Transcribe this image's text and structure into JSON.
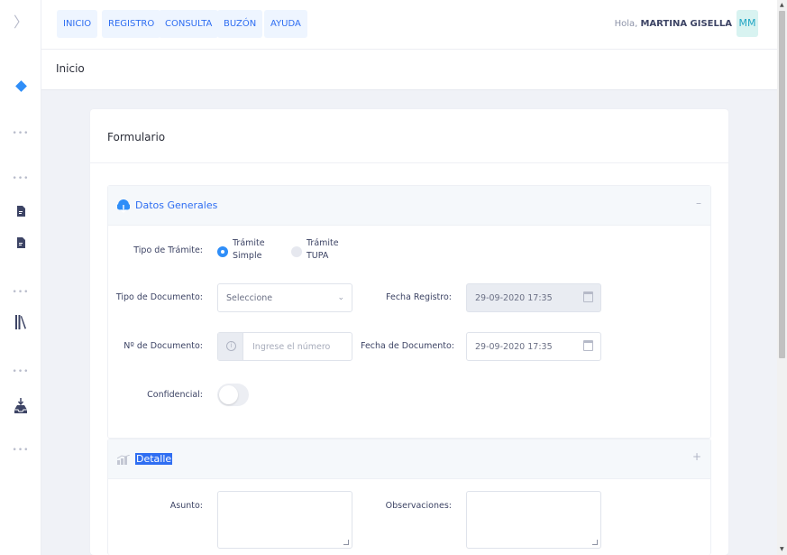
{
  "rail": {
    "expander": "〉",
    "dots": "•••"
  },
  "topbar": {
    "nav": [
      "INICIO",
      "REGISTRO",
      "CONSULTA",
      "BUZÓN",
      "AYUDA"
    ],
    "greeting_prefix": "Hola, ",
    "user_name": "MARTINA GISELLA",
    "avatar_initials": "MM"
  },
  "subheader": {
    "title": "Inicio"
  },
  "card": {
    "title": "Formulario",
    "general": {
      "title": "Datos Generales",
      "toggle": "–",
      "tipo_tramite_label": "Tipo de Trámite:",
      "opt_simple_1": "Trámite",
      "opt_simple_2": "Simple",
      "opt_tupa_1": "Trámite",
      "opt_tupa_2": "TUPA",
      "tipo_documento_label": "Tipo de Documento:",
      "tipo_documento_value": "Seleccione",
      "fecha_registro_label": "Fecha Registro:",
      "fecha_registro_value": "29-09-2020 17:35",
      "nro_documento_label": "Nº de Documento:",
      "nro_documento_placeholder": "Ingrese el número",
      "fecha_documento_label": "Fecha de Documento:",
      "fecha_documento_value": "29-09-2020 17:35",
      "confidencial_label": "Confidencial:"
    },
    "detalle": {
      "title": "Detalle",
      "toggle": "+",
      "asunto_label": "Asunto:",
      "observaciones_label": "Observaciones:"
    }
  },
  "colors": {
    "accent": "#2f6ef2",
    "radio": "#2f8ef8",
    "avatar_bg": "#d8f3f1"
  }
}
